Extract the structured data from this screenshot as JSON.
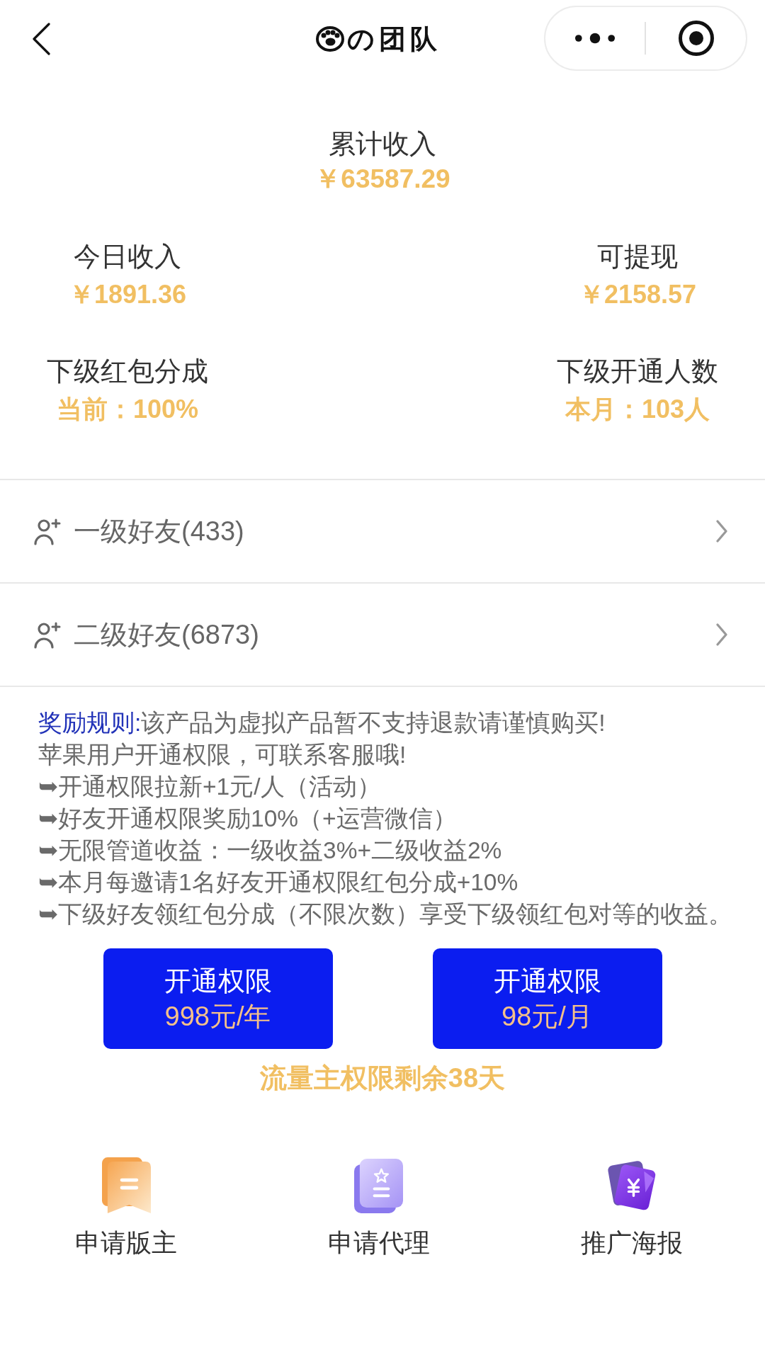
{
  "nav": {
    "title": "の团队"
  },
  "total": {
    "label": "累计收入",
    "value": "￥63587.29"
  },
  "stats": [
    {
      "label": "今日收入",
      "value": "￥1891.36"
    },
    {
      "label": "可提现",
      "value": "￥2158.57"
    },
    {
      "label": "下级红包分成",
      "value": "当前：100%"
    },
    {
      "label": "下级开通人数",
      "value": "本月：103人"
    }
  ],
  "friends": [
    {
      "label": "一级好友(433)"
    },
    {
      "label": "二级好友(6873)"
    }
  ],
  "rules": {
    "label": "奖励规则:",
    "intro": "该产品为虚拟产品暂不支持退款请谨慎购买!",
    "lines": [
      "苹果用户开通权限，可联系客服哦!",
      "➥开通权限拉新+1元/人（活动）",
      "➥好友开通权限奖励10%（+运营微信）",
      "➥无限管道收益：一级收益3%+二级收益2%",
      "➥本月每邀请1名好友开通权限红包分成+10%",
      "➥下级好友领红包分成（不限次数）享受下级领红包对等的收益。"
    ]
  },
  "plans": [
    {
      "title": "开通权限",
      "price": "998元/年"
    },
    {
      "title": "开通权限",
      "price": "98元/月"
    }
  ],
  "remaining": "流量主权限剩余38天",
  "actions": [
    {
      "kind": "moderator",
      "label": "申请版主"
    },
    {
      "kind": "agent",
      "label": "申请代理"
    },
    {
      "kind": "poster",
      "label": "推广海报"
    }
  ]
}
